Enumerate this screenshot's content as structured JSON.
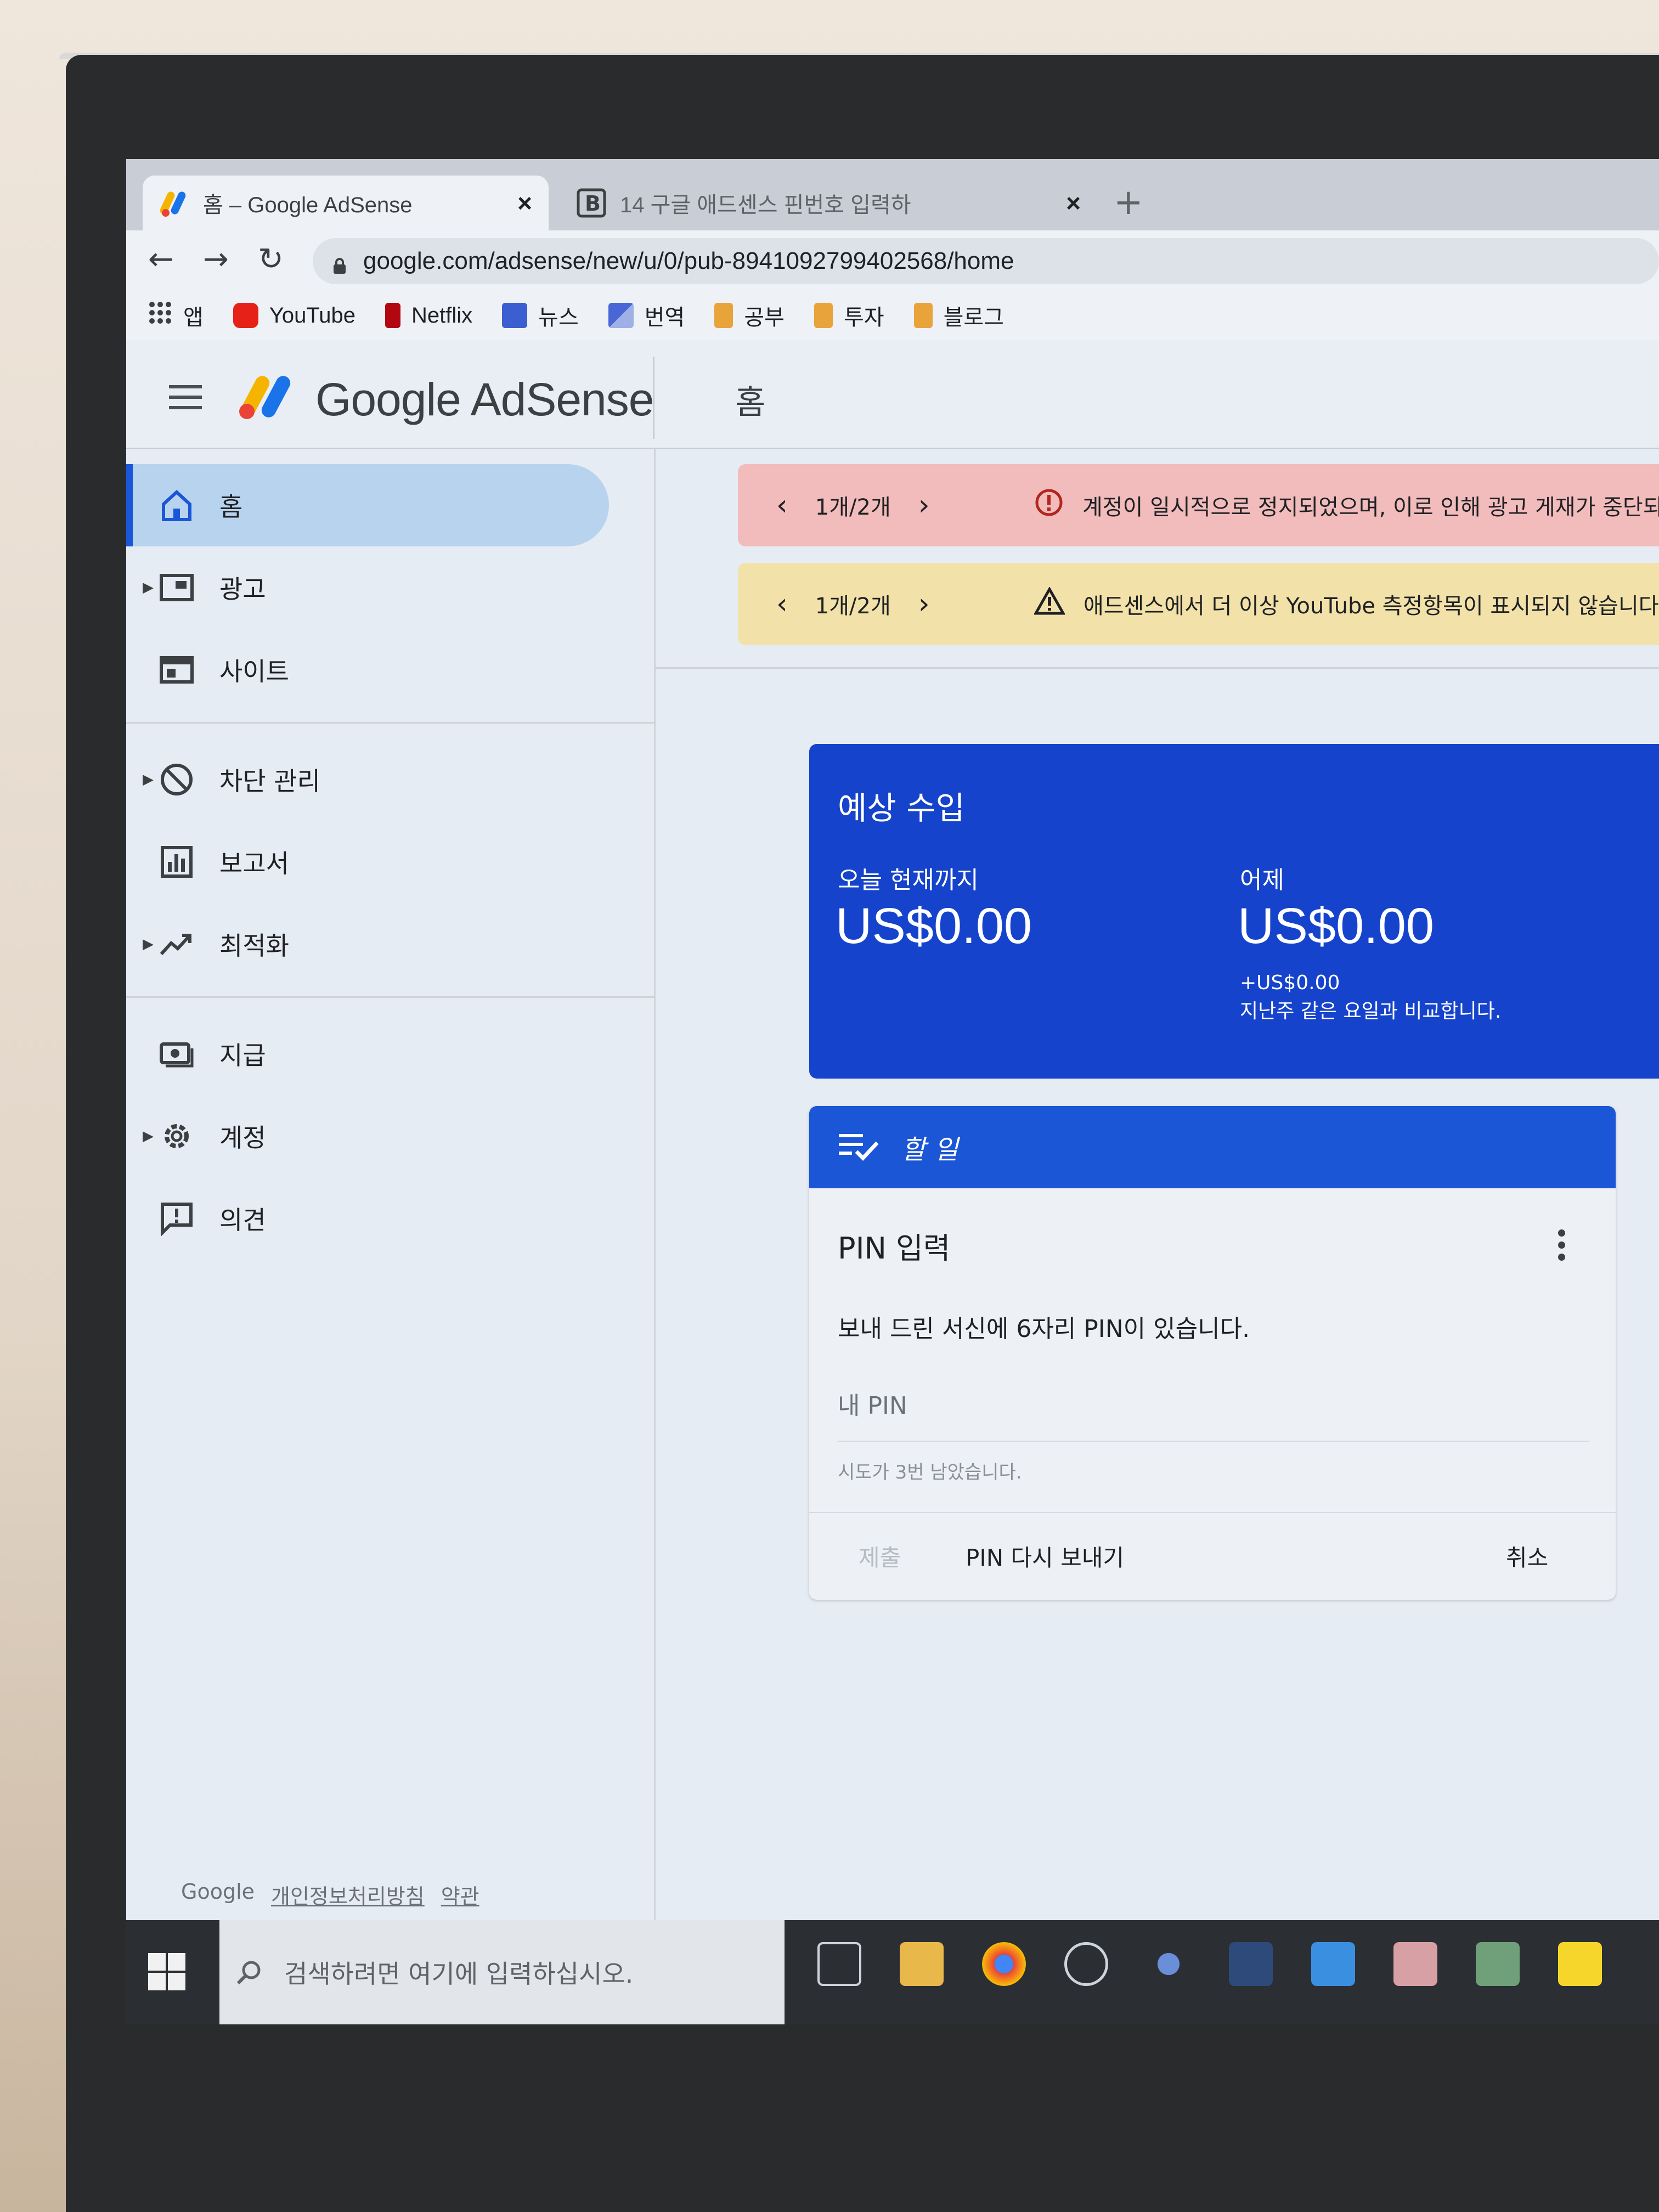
{
  "browser": {
    "tabs": [
      {
        "title": "홈 – Google AdSense",
        "close": "×"
      },
      {
        "title": "14 구글 애드센스 핀번호 입력하",
        "close": "×"
      }
    ],
    "new_tab": "+",
    "url": "google.com/adsense/new/u/0/pub-8941092799402568/home",
    "bookmarks": [
      {
        "label": "앱",
        "icon": "apps-grid-icon"
      },
      {
        "label": "YouTube",
        "icon": "youtube-icon"
      },
      {
        "label": "Netflix",
        "icon": "netflix-icon"
      },
      {
        "label": "뉴스",
        "icon": "news-icon"
      },
      {
        "label": "번역",
        "icon": "translate-icon"
      },
      {
        "label": "공부",
        "icon": "folder-icon"
      },
      {
        "label": "투자",
        "icon": "folder-icon"
      },
      {
        "label": "블로그",
        "icon": "folder-icon"
      }
    ]
  },
  "header": {
    "brand": "Google AdSense",
    "page_title": "홈"
  },
  "sidebar": {
    "items": [
      {
        "label": "홈",
        "icon": "home-icon"
      },
      {
        "label": "광고",
        "icon": "ads-icon"
      },
      {
        "label": "사이트",
        "icon": "sites-icon"
      },
      {
        "label": "차단 관리",
        "icon": "block-icon"
      },
      {
        "label": "보고서",
        "icon": "reports-icon"
      },
      {
        "label": "최적화",
        "icon": "trending-icon"
      },
      {
        "label": "지급",
        "icon": "payments-icon"
      },
      {
        "label": "계정",
        "icon": "gear-icon"
      },
      {
        "label": "의견",
        "icon": "feedback-icon"
      }
    ],
    "footer": {
      "google": "Google",
      "privacy": "개인정보처리방침",
      "terms": "약관"
    }
  },
  "alerts": [
    {
      "pager": "1개/2개",
      "message": "계정이 일시적으로 정지되었으며, 이로 인해 광고 게재가 중단되",
      "color": "#f2bcbc"
    },
    {
      "pager": "1개/2개",
      "message": "애드센스에서 더 이상 YouTube 측정항목이 표시되지 않습니다",
      "color": "#f2e2a9"
    }
  ],
  "earnings": {
    "title": "예상 수입",
    "today_label": "오늘 현재까지",
    "today_amount": "US$0.00",
    "yesterday_label": "어제",
    "yesterday_amount": "US$0.00",
    "yesterday_change": "+US$0.00",
    "yesterday_compare": "지난주 같은 요일과 비교합니다."
  },
  "todo": {
    "header": "할 일",
    "title": "PIN 입력",
    "description": "보내 드린 서신에 6자리 PIN이 있습니다.",
    "input_placeholder": "내 PIN",
    "hint": "시도가 3번 남았습니다.",
    "submit": "제출",
    "resend": "PIN 다시 보내기",
    "cancel": "취소"
  },
  "taskbar": {
    "search_placeholder": "검색하려면 여기에 입력하십시오."
  },
  "colors": {
    "accent_blue": "#1a56d6",
    "earnings_blue": "#1543cc",
    "error_bg": "#f2bcbc",
    "warning_bg": "#f2e2a9"
  }
}
